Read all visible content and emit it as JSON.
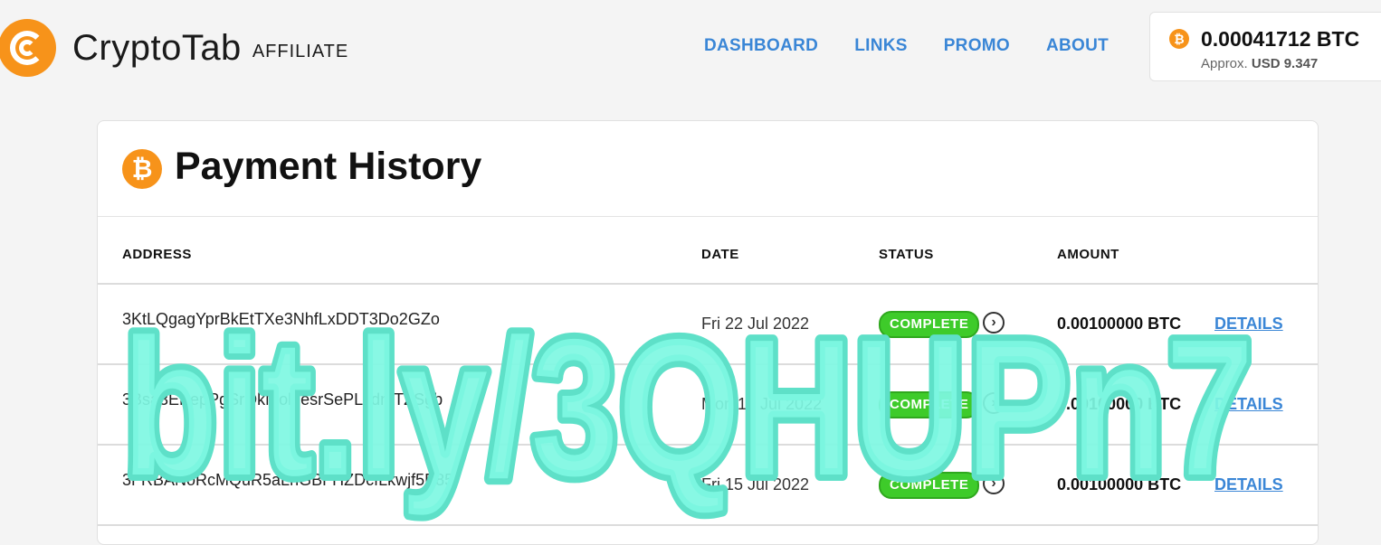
{
  "header": {
    "brand": "CryptoTab",
    "brand_sub": "AFFILIATE",
    "nav": [
      {
        "label": "DASHBOARD"
      },
      {
        "label": "LINKS"
      },
      {
        "label": "PROMO"
      },
      {
        "label": "ABOUT"
      }
    ],
    "balance": {
      "amount": "0.00041712 BTC",
      "approx_label": "Approx.",
      "usd": "USD 9.347"
    }
  },
  "card": {
    "title": "Payment History",
    "columns": {
      "address": "ADDRESS",
      "date": "DATE",
      "status": "STATUS",
      "amount": "AMOUNT"
    },
    "rows": [
      {
        "address": "3KtLQgagYprBkEtTXe3NhfLxDDT3Do2GZo",
        "date": "Fri 22 Jul 2022",
        "status": "COMPLETE",
        "amount": "0.00100000 BTC",
        "details": "DETAILS"
      },
      {
        "address": "3Bsa3EPepPgSrQkMobjesrSePLvdmTZSgb",
        "date": "Mon 18 Jul 2022",
        "status": "COMPLETE",
        "amount": "0.00100000 BTC",
        "details": "DETAILS"
      },
      {
        "address": "3FRBANoRcMQuR5aLnGBFHZDcfLkwjf5P85",
        "date": "Fri 15 Jul 2022",
        "status": "COMPLETE",
        "amount": "0.00100000 BTC",
        "details": "DETAILS"
      }
    ]
  },
  "watermark": {
    "text": "bit.ly/3QHUPn7",
    "fill": "#7ef7e2",
    "outline": "#5ee0c8"
  },
  "colors": {
    "brand_orange": "#f7931a",
    "link_blue": "#3a86d6",
    "status_green": "#3ecb2a"
  },
  "icons": {
    "logo": "cryptotab-logo-icon",
    "bitcoin": "bitcoin-icon",
    "row_arrow": "chevron-right-circle-icon"
  }
}
